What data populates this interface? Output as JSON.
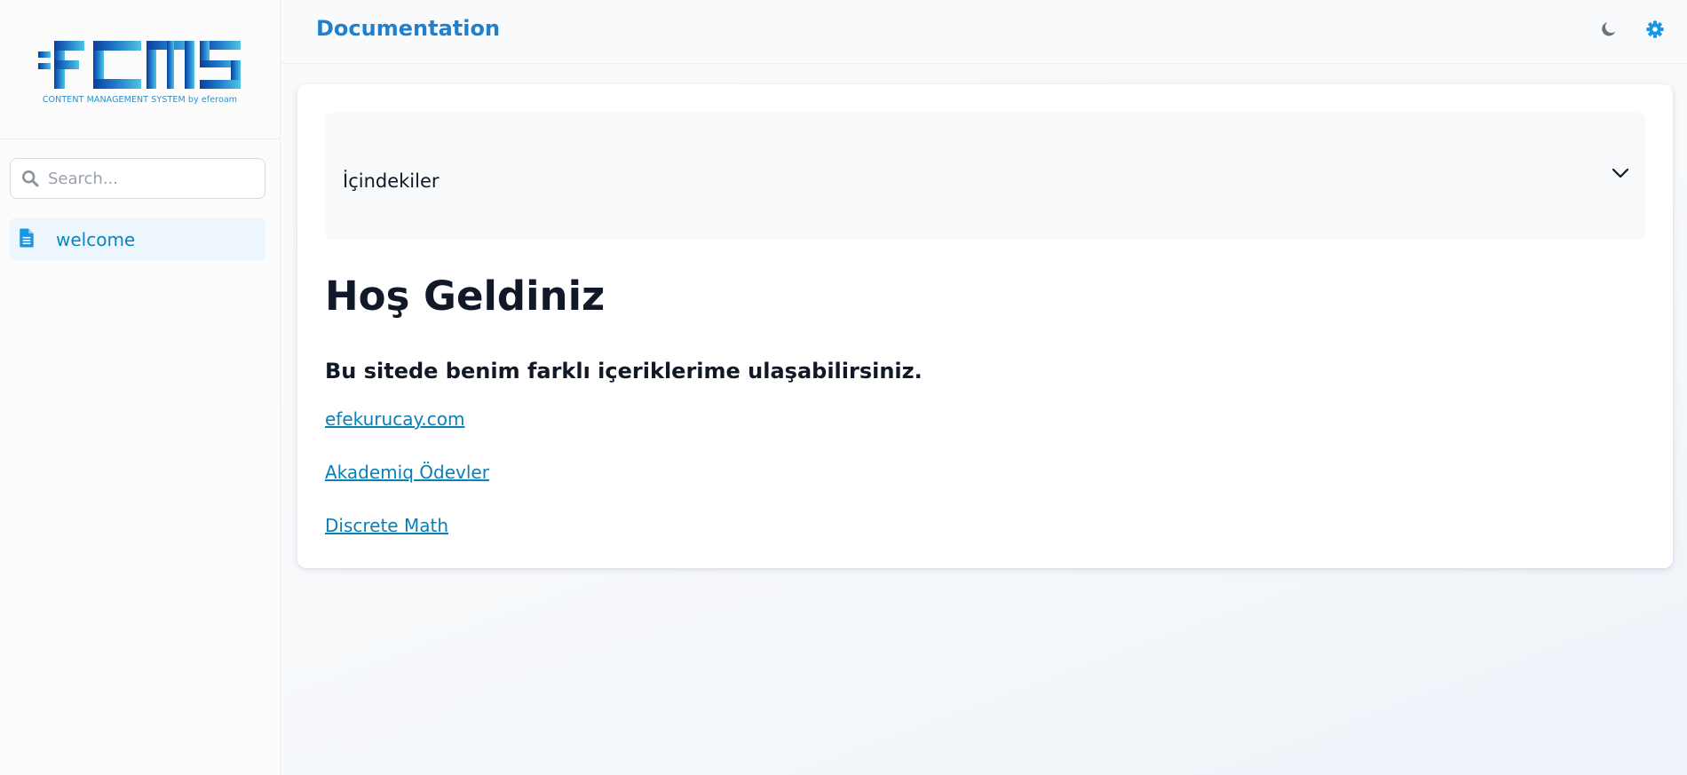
{
  "logo": {
    "wordmark": "FCMS",
    "tagline": "CONTENT MANAGEMENT SYSTEM by eferoam"
  },
  "search": {
    "placeholder": "Search...",
    "icon": "search-icon"
  },
  "sidebar": {
    "items": [
      {
        "label": "welcome",
        "icon": "file-text-icon",
        "active": true
      }
    ]
  },
  "header": {
    "title": "Documentation",
    "icons": [
      "moon-icon",
      "gear-icon"
    ]
  },
  "toc": {
    "label": "İçindekiler",
    "icon": "chevron-down-icon"
  },
  "content": {
    "heading": "Hoş Geldiniz",
    "subheading": "Bu sitede benim farklı içeriklerime ulaşabilirsiniz.",
    "links": [
      {
        "label": "efekurucay.com"
      },
      {
        "label": "Akademiq Ödevler"
      },
      {
        "label": "Discrete Math"
      }
    ]
  },
  "colors": {
    "accent": "#1f80d0",
    "link": "#0b7fb6",
    "active_item_bg": "#eef6fd",
    "gear": "#1796e6",
    "moon": "#6b7280"
  }
}
